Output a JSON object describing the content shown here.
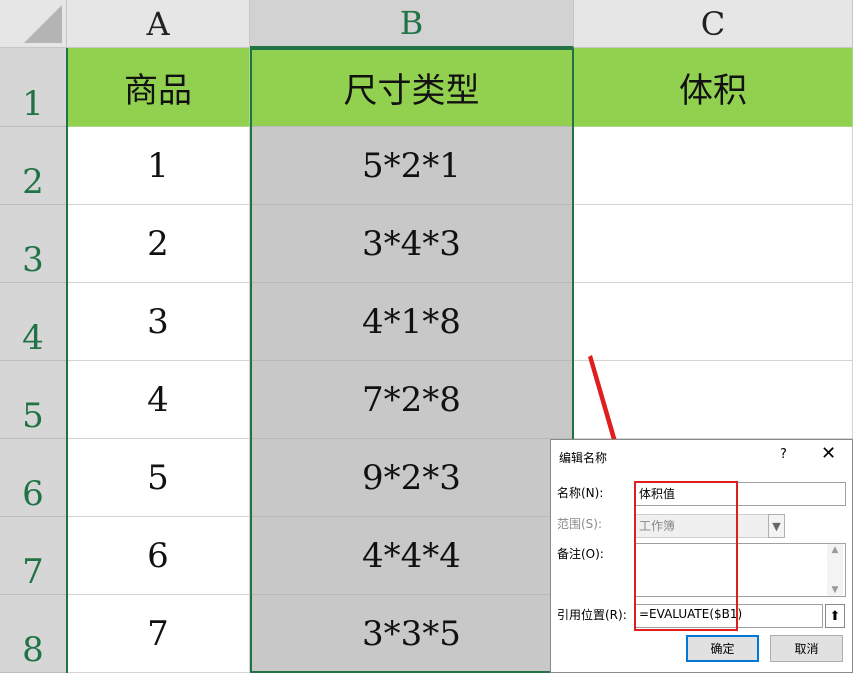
{
  "sheet": {
    "columns": [
      "A",
      "B",
      "C"
    ],
    "rows": [
      "1",
      "2",
      "3",
      "4",
      "5",
      "6",
      "7",
      "8"
    ],
    "header_row": [
      "商品",
      "尺寸类型",
      "体积"
    ],
    "data_rows": [
      [
        "1",
        "5*2*1",
        ""
      ],
      [
        "2",
        "3*4*3",
        ""
      ],
      [
        "3",
        "4*1*8",
        ""
      ],
      [
        "4",
        "7*2*8",
        ""
      ],
      [
        "5",
        "9*2*3",
        ""
      ],
      [
        "6",
        "4*4*4",
        ""
      ],
      [
        "7",
        "3*3*5",
        ""
      ]
    ]
  },
  "dialog": {
    "title": "编辑名称",
    "help": "?",
    "close": "✕",
    "name_label": "名称(N):",
    "name_value": "体积值",
    "scope_label": "范围(S):",
    "scope_value": "工作簿",
    "comment_label": "备注(O):",
    "comment_value": "",
    "refers_label": "引用位置(R):",
    "refers_value": "=EVALUATE($B1)",
    "ok": "确定",
    "cancel": "取消"
  },
  "colors": {
    "header_fill": "#92d050",
    "selection_fill": "#c8c8c8",
    "selection_border": "#217346",
    "annotation_red": "#e01e1e"
  }
}
